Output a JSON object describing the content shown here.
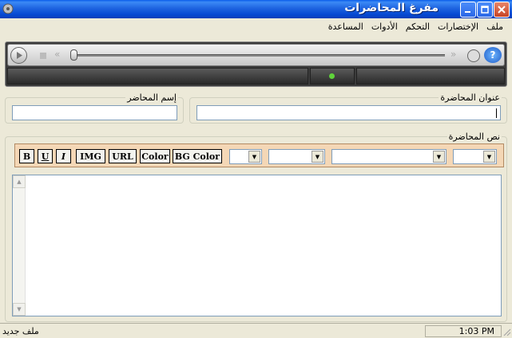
{
  "window": {
    "title": "مفرغ المحاضرات"
  },
  "menu": [
    "ملف",
    "الإختصارات",
    "التحكم",
    "الأدوات",
    "المساعدة"
  ],
  "player": {
    "logo": "?"
  },
  "lecture_title": {
    "label": "عنوان المحاضرة",
    "value": ""
  },
  "lecturer": {
    "label": "إسم المحاضر",
    "value": ""
  },
  "lecture_text": {
    "label": "نص المحاضرة",
    "content": ""
  },
  "toolbar": {
    "buttons": [
      "B",
      "U",
      "I",
      "IMG",
      "URL",
      "Color",
      "BG Color"
    ]
  },
  "status": {
    "left": "ملف جديد",
    "time": "1:03 PM"
  }
}
